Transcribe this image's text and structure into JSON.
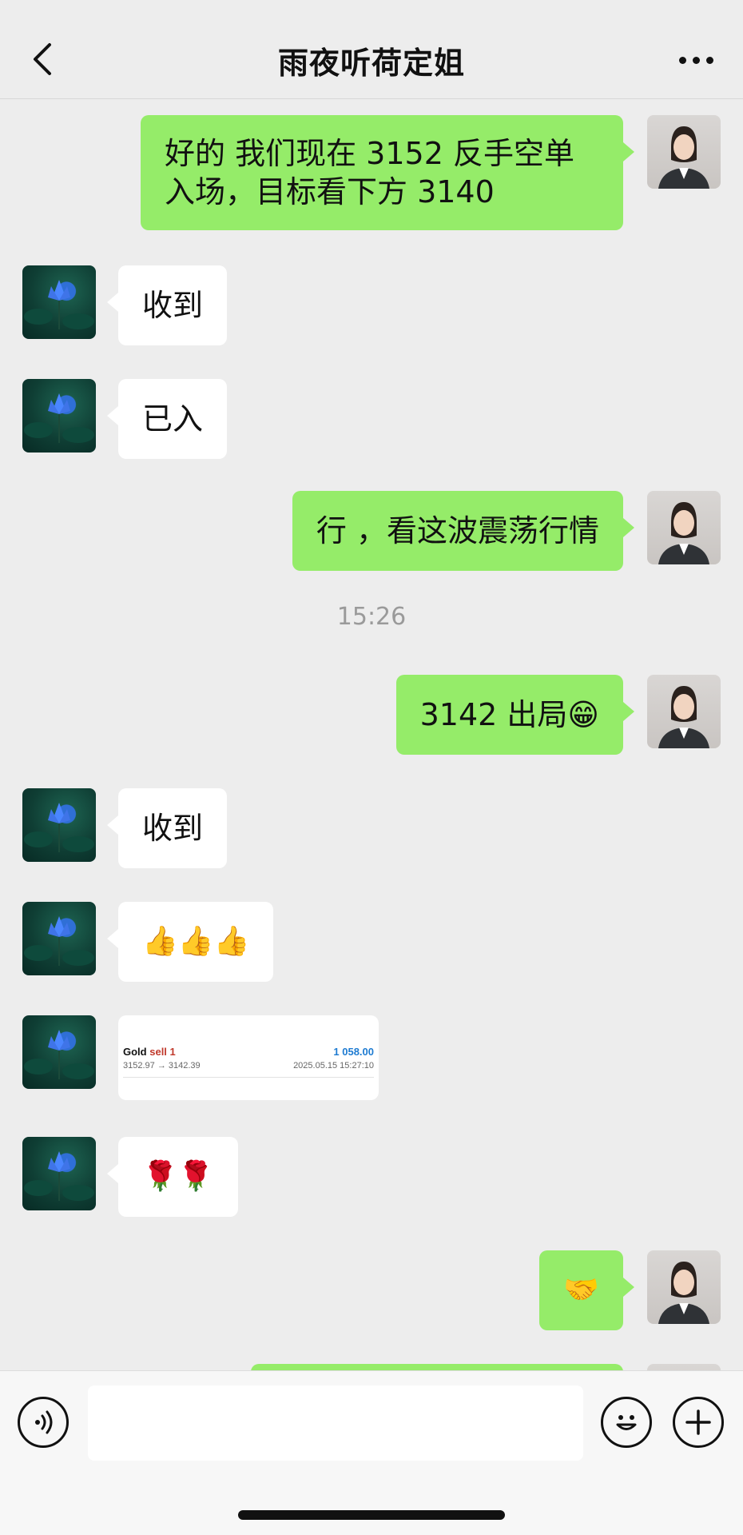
{
  "header": {
    "title": "雨夜听荷定姐",
    "back_icon": "chevron-left-icon",
    "more_icon": "more-horizontal-icon"
  },
  "messages": [
    {
      "side": "right",
      "text": "好的 我们现在 3152 反手空单入场，目标看下方 3140"
    },
    {
      "side": "left",
      "text": "收到"
    },
    {
      "side": "left",
      "text": "已入"
    },
    {
      "side": "right",
      "text": "行 ，看这波震荡行情"
    },
    {
      "side": "right",
      "text": "3142 出局😁"
    },
    {
      "side": "left",
      "text": "收到"
    },
    {
      "side": "left",
      "text": "👍👍👍"
    },
    {
      "side": "left",
      "type": "card"
    },
    {
      "side": "left",
      "text": "🌹🌹"
    },
    {
      "side": "right",
      "text": "🤝"
    }
  ],
  "timestamp": "15:26",
  "trade_card": {
    "symbol": "Gold",
    "action": "sell 1",
    "amount": "1 058.00",
    "prices": "3152.97 → 3142.39",
    "datetime": "2025.05.15 15:27:10"
  },
  "input_bar": {
    "voice_icon": "voice-icon",
    "emoji_icon": "emoji-icon",
    "plus_icon": "plus-icon",
    "placeholder": ""
  },
  "colors": {
    "background": "#ededed",
    "sent_bubble": "#95ec69",
    "received_bubble": "#ffffff",
    "trade_amount": "#1e7bd1",
    "trade_action": "#c0392b"
  }
}
